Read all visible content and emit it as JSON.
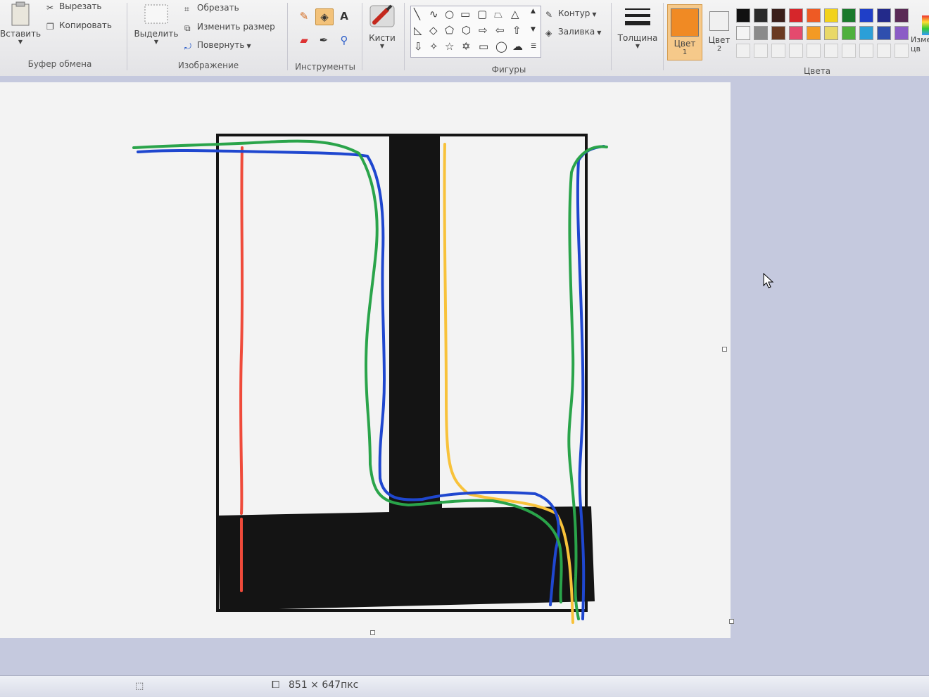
{
  "ribbon": {
    "clipboard": {
      "paste_label": "Вставить",
      "cut_label": "Вырезать",
      "copy_label": "Копировать",
      "group_label": "Буфер обмена"
    },
    "image": {
      "select_label": "Выделить",
      "crop_label": "Обрезать",
      "resize_label": "Изменить размер",
      "rotate_label": "Повернуть",
      "group_label": "Изображение"
    },
    "tools": {
      "group_label": "Инструменты"
    },
    "brushes": {
      "label": "Кисти"
    },
    "shapes": {
      "outline_label": "Контур",
      "fill_label": "Заливка",
      "group_label": "Фигуры"
    },
    "thickness": {
      "label": "Толщина"
    },
    "color1": {
      "label": "Цвет",
      "sub": "1",
      "value": "#f08a24"
    },
    "color2": {
      "label": "Цвет",
      "sub": "2",
      "value": "#f0f0f0"
    },
    "colors": {
      "group_label": "Цвета",
      "edit_label_partial": "Изме цв",
      "row1": [
        "#111111",
        "#2a2a2a",
        "#3a1f1a",
        "#d6262b",
        "#ee5a24",
        "#f2d21b",
        "#1a7a2c",
        "#1f3fc8",
        "#232a8a",
        "#5a2a55"
      ],
      "row2": [
        "#f4f4f4",
        "#8a8a8a",
        "#6a3a22",
        "#e44a6e",
        "#f39a24",
        "#e9d868",
        "#4fb03d",
        "#2b9fd8",
        "#2f4fae",
        "#8b5cc6"
      ]
    }
  },
  "statusbar": {
    "dimensions": "851 × 647пкс"
  },
  "colors": {
    "red_line": "#ef4a3a",
    "blue_line": "#1f47cf",
    "green_line": "#2aa44a",
    "yellow_line": "#f8c23a",
    "black_fill": "#141414"
  }
}
